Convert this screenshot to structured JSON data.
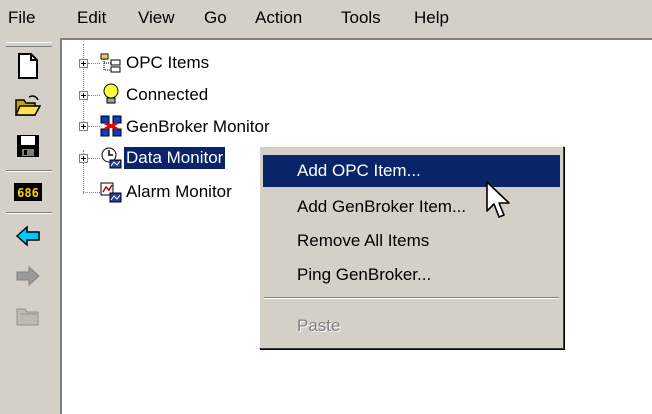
{
  "menubar": {
    "items": [
      "File",
      "Edit",
      "View",
      "Go",
      "Action",
      "Tools",
      "Help"
    ]
  },
  "toolbar": {
    "buttons": [
      {
        "icon": "new-document-icon"
      },
      {
        "icon": "open-folder-icon"
      },
      {
        "icon": "save-disk-icon"
      },
      {
        "icon": "counter-icon",
        "label": "686"
      },
      {
        "icon": "back-arrow-icon"
      },
      {
        "icon": "forward-arrow-icon"
      },
      {
        "icon": "folder-disabled-icon"
      }
    ]
  },
  "tree": {
    "items": [
      {
        "label": "OPC Items",
        "icon": "opc-items-icon"
      },
      {
        "label": "Connected",
        "icon": "lightbulb-icon"
      },
      {
        "label": "GenBroker Monitor",
        "icon": "network-icon"
      },
      {
        "label": "Data Monitor",
        "icon": "data-monitor-icon"
      },
      {
        "label": "Alarm Monitor",
        "icon": "alarm-monitor-icon"
      }
    ]
  },
  "context_menu": {
    "items": [
      "Add OPC Item...",
      "Add GenBroker Item...",
      "Remove All Items",
      "Ping GenBroker...",
      "Paste"
    ]
  },
  "colors": {
    "selection": "#0a246a",
    "face": "#d4d0c8",
    "disabled": "#808080"
  }
}
